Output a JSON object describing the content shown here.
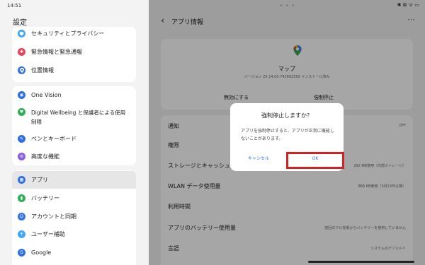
{
  "status_bar": {
    "time": "14:51",
    "icons": "✱ ⊠ ᯤ ▭",
    "handle": "• • •"
  },
  "settings": {
    "title": "設定",
    "groups": [
      [
        {
          "label": "セキュリティとプライバシー",
          "icon": "shield-icon",
          "color": "#3ea6ff"
        },
        {
          "label": "緊急情報と緊急通報",
          "icon": "asterisk-icon",
          "color": "#e8445a"
        },
        {
          "label": "位置情報",
          "icon": "location-pin-icon",
          "color": "#2f6fe4"
        }
      ],
      [
        {
          "label": "One Vision",
          "icon": "vision-icon",
          "color": "#2f6fe4"
        },
        {
          "label": "Digital Wellbeing と保護者による使用制限",
          "icon": "wellbeing-icon",
          "color": "#2fae58"
        },
        {
          "label": "ペンとキーボード",
          "icon": "pen-icon",
          "color": "#2f6fe4"
        },
        {
          "label": "高度な機能",
          "icon": "gear-icon",
          "color": "#8a5ae0"
        }
      ],
      [
        {
          "label": "アプリ",
          "icon": "apps-grid-icon",
          "color": "#2f6fe4",
          "selected": true
        },
        {
          "label": "バッテリー",
          "icon": "battery-icon",
          "color": "#2fae58"
        },
        {
          "label": "アカウントと同期",
          "icon": "account-icon",
          "color": "#2f6fe4"
        },
        {
          "label": "ユーザー補助",
          "icon": "accessibility-icon",
          "color": "#3ea6ff"
        },
        {
          "label": "Google",
          "icon": "google-icon",
          "color": "#2f6fe4"
        }
      ]
    ]
  },
  "app_info": {
    "title": "アプリ情報",
    "app_name": "マップ",
    "version": "バージョン 25.14.00.742602593 インストール済み",
    "disable_label": "無効にする",
    "force_stop_label": "強制停止",
    "rows": [
      {
        "label": "通知",
        "value": "OFF"
      },
      {
        "label": "権限",
        "value": ""
      },
      {
        "label": "ストレージとキャッシュ",
        "value": "292 MB使用（内部ストレージ）"
      },
      {
        "label": "WLAN データ使用量",
        "value": "866 KB使用（3月13日以降）"
      },
      {
        "label": "利用時間",
        "value": ""
      },
      {
        "label": "アプリのバッテリー使用量",
        "value": "前回のフル充電からバッテリーを使用していません"
      },
      {
        "label": "言語",
        "value": "システムのデフォルト"
      }
    ]
  },
  "dialog": {
    "title": "強制停止しますか？",
    "message": "アプリを強制停止すると、アプリが正常に機能しないことがあります。",
    "cancel_label": "キャンセル",
    "ok_label": "OK",
    "highlight_color": "#d42222"
  }
}
